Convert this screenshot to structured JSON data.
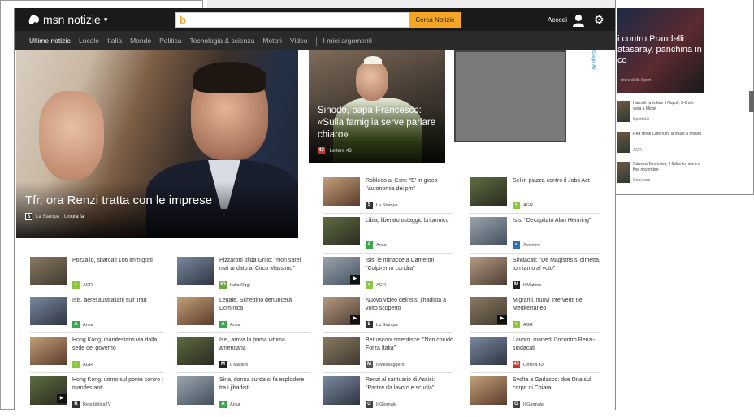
{
  "background": {
    "right_hero_title": "i contro Prandelli: atasaray, panchina in co",
    "right_hero_source": "rriera dello Sport",
    "right_items": [
      {
        "text": "Hamsik fa volare il Napoli, 3-0 dei viola a Minsk",
        "source": "Sportal.it"
      },
      {
        "text": "Red Hook Criterium: la finale a Milano",
        "source": "AGR"
      },
      {
        "text": "Calvario Montolivo, il Milan lo riavrà a fine novembre",
        "source": "Goal.com"
      }
    ]
  },
  "header": {
    "brand": "msn notizie",
    "search_button": "Cerca Notizie",
    "search_placeholder": "",
    "signin": "Accedi"
  },
  "nav": {
    "items": [
      "Ultime notizie",
      "Locale",
      "Italia",
      "Mondo",
      "Politica",
      "Tecnologia & scienza",
      "Motori",
      "Video"
    ],
    "my_topics": "I miei argomenti"
  },
  "hero": {
    "title": "Tfr, ora Renzi tratta con le imprese",
    "source": "La Stampa",
    "time": "Un'ora fa"
  },
  "feature": {
    "title": "Sinodo, papa Francesco: «Sulla famiglia serve parlare chiaro»",
    "source": "Lettera 43"
  },
  "ad_info": "Google Ad",
  "col1": [
    {
      "title": "Pozzallo, sbarcati 106 immigrati",
      "source": "AGR",
      "color": "#8dc63f",
      "logo": "◐"
    },
    {
      "title": "Isis, aerei australiani sull' Iraq",
      "source": "Ansa",
      "color": "#3aa74a",
      "logo": "A"
    },
    {
      "title": "Hong Kong, manifestanti via dalla sede del governo",
      "source": "AGR",
      "color": "#8dc63f",
      "logo": "◐"
    },
    {
      "title": "Hong Kong, uomo sul ponte contro i manifestanti",
      "source": "RepubblicaTV",
      "color": "#333333",
      "logo": "R"
    }
  ],
  "col2": [
    {
      "title": "Pizzarotti sfida Grillo: \"Non sarei mai andato al Circo Massimo\"",
      "source": "Italia Oggi",
      "color": "#6aa83a",
      "logo": "IO"
    },
    {
      "title": "Legale, Schettino denuncerà Dominica",
      "source": "Ansa",
      "color": "#3aa74a",
      "logo": "A"
    },
    {
      "title": "Isis, arriva la prima vittima americana",
      "source": "Il Mattino",
      "color": "#222222",
      "logo": "M"
    },
    {
      "title": "Siria, donna curda si fa esplodere tra i jihadisti",
      "source": "Ansa",
      "color": "#3aa74a",
      "logo": "A"
    }
  ],
  "col3": [
    {
      "title": "Robledo al Csm: \"E' in gioco l'autonomia dei pm\"",
      "source": "La Stampa",
      "color": "#333333",
      "logo": "S"
    },
    {
      "title": "Libia, liberato ostaggio britannico",
      "source": "Ansa",
      "color": "#3aa74a",
      "logo": "A"
    },
    {
      "title": "Isis, le minacce a Cameron: \"Colpiremo Londra\"",
      "source": "AGR",
      "color": "#8dc63f",
      "logo": "◐"
    },
    {
      "title": "Nuovo video dell'Isis, jihadista a volto scoperto",
      "source": "La Stampa",
      "color": "#333333",
      "logo": "S"
    },
    {
      "title": "Berlusconi smentisce: \"Non chiudo Forza Italia\"",
      "source": "Il Messaggero",
      "color": "#555555",
      "logo": "M"
    },
    {
      "title": "Renzi al santuario di Assisi: \"Partire da lavoro e scuola\"",
      "source": "Il Giornale",
      "color": "#444444",
      "logo": "G"
    }
  ],
  "col4": [
    {
      "title": "Sel in piazza contro il Jobs Act",
      "source": "AGR",
      "color": "#8dc63f",
      "logo": "◐"
    },
    {
      "title": "Isis: \"Decapitato Alan Henning\"",
      "source": "Avvenire",
      "color": "#2f6db5",
      "logo": "◐"
    },
    {
      "title": "Sindacati: \"De Magistris si dimetta, torniamo al voto\"",
      "source": "Il Mattino",
      "color": "#222222",
      "logo": "M"
    },
    {
      "title": "Migranti, nuovi interventi nel Mediterraneo",
      "source": "AGR",
      "color": "#8dc63f",
      "logo": "◐"
    },
    {
      "title": "Lavoro, martedì l'incontro Renzi-sindacati",
      "source": "Lettera 43",
      "color": "#c0392b",
      "logo": "43"
    },
    {
      "title": "Svolta a Garlasco: due Dna sul corpo di Chiara",
      "source": "Il Giornale",
      "color": "#444444",
      "logo": "G"
    }
  ]
}
